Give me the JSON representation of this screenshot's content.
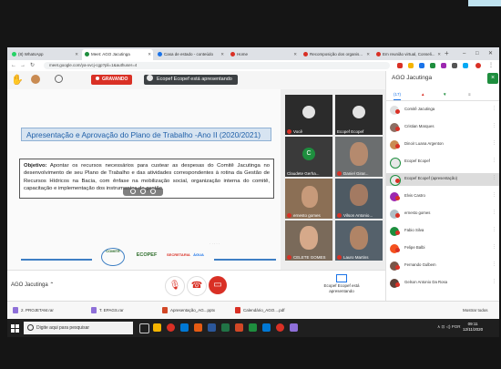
{
  "browser": {
    "tabs": [
      {
        "label": "(8) WhatsApp",
        "color": "#25d366"
      },
      {
        "label": "Meet: AGO Jacutinga",
        "color": "#1e8e3e",
        "active": true
      },
      {
        "label": "Casa de estado - conteúdo",
        "color": "#1a73e8"
      },
      {
        "label": "Home",
        "color": "#d93025"
      },
      {
        "label": "Recomposição dos organis...",
        "color": "#d93025"
      },
      {
        "label": "Em reunião virtual, Conseli...",
        "color": "#d93025"
      }
    ],
    "new_tab": "+",
    "url": "meet.google.com/ya-xvcj-cgp?pli=1&authuser=4"
  },
  "meet": {
    "recording_label": "GRAVANDO",
    "presenting_label": "Ecopef Ecopef está apresentando",
    "meeting_name": "AGO Jacutinga",
    "presenting_box_label": "Ecopef Ecopef está apresentando"
  },
  "slide": {
    "title": "Apresentação e Aprovação do Plano de Trabalho -Ano II (2020/2021)",
    "objective_label": "Objetivo:",
    "objective_text": "Apontar os recursos necessários para custear as despesas do Comitê Jacutinga no desenvolvimento de seu Plano de Trabalho e das atividades correspondentes à rotina da Gestão de Recursos Hídricos na Bacia, com ênfase na mobilização social, organização interna do comitê, capacitação e implementação dos instrumentos de gestão.",
    "logo_labels": [
      "COMITÊ",
      "ECOPEF",
      "SECRETARIA",
      "ÁGUA"
    ]
  },
  "video_tiles": [
    {
      "name": "Você"
    },
    {
      "name": "Ecopef Ecopef"
    },
    {
      "name": "Claudete Gerha...",
      "initial": "C"
    },
    {
      "name": "Daniel Girar..."
    },
    {
      "name": "ernesto gomes"
    },
    {
      "name": "Vilson Antonio..."
    },
    {
      "name": "CELETE GOMES"
    },
    {
      "name": "Lauro Martins"
    }
  ],
  "panel": {
    "title": "AGO Jacutinga",
    "close": "×",
    "tabs": [
      "(17)",
      "▲",
      "▼",
      "≡"
    ],
    "participants": [
      {
        "name": "Comitê Jacutinga",
        "color": "#e8e8e8"
      },
      {
        "name": "Cristian Marques",
        "color": "#8d6e63"
      },
      {
        "name": "Dinoir Luana Argenton",
        "color": "#c98b52"
      },
      {
        "name": "Ecopef Ecopef",
        "color": "#e8e8e8"
      },
      {
        "name": "Ecopef Ecopef (apresentação)",
        "color": "#e8e8e8"
      },
      {
        "name": "Elvis Castro",
        "color": "#9c27b0"
      },
      {
        "name": "ernesto gomes",
        "color": "#b0bec5"
      },
      {
        "name": "Fabio Silva",
        "color": "#1e8e3e"
      },
      {
        "name": "Felipe Balbi",
        "color": "#f4511e"
      },
      {
        "name": "Fernando Gulbem",
        "color": "#795548"
      },
      {
        "name": "Gelson Antonio Da Rosa",
        "color": "#5d4037"
      }
    ]
  },
  "downloads": [
    {
      "label": "2. PROJETAM.rar",
      "color": "#8e6fd8"
    },
    {
      "label": "T. EPAGS.rar",
      "color": "#8e6fd8"
    },
    {
      "label": "Apresentação_AG...pptx",
      "color": "#d24726"
    },
    {
      "label": "Calendário_AGO....pdf",
      "color": "#d93025"
    }
  ],
  "downloads_showall": "Mostrar todos",
  "taskbar": {
    "search_placeholder": "Digite aqui para pesquisar",
    "tray_text": "∧ ⊡ ◁) POR",
    "time": "09:11",
    "date": "12/11/2020"
  }
}
